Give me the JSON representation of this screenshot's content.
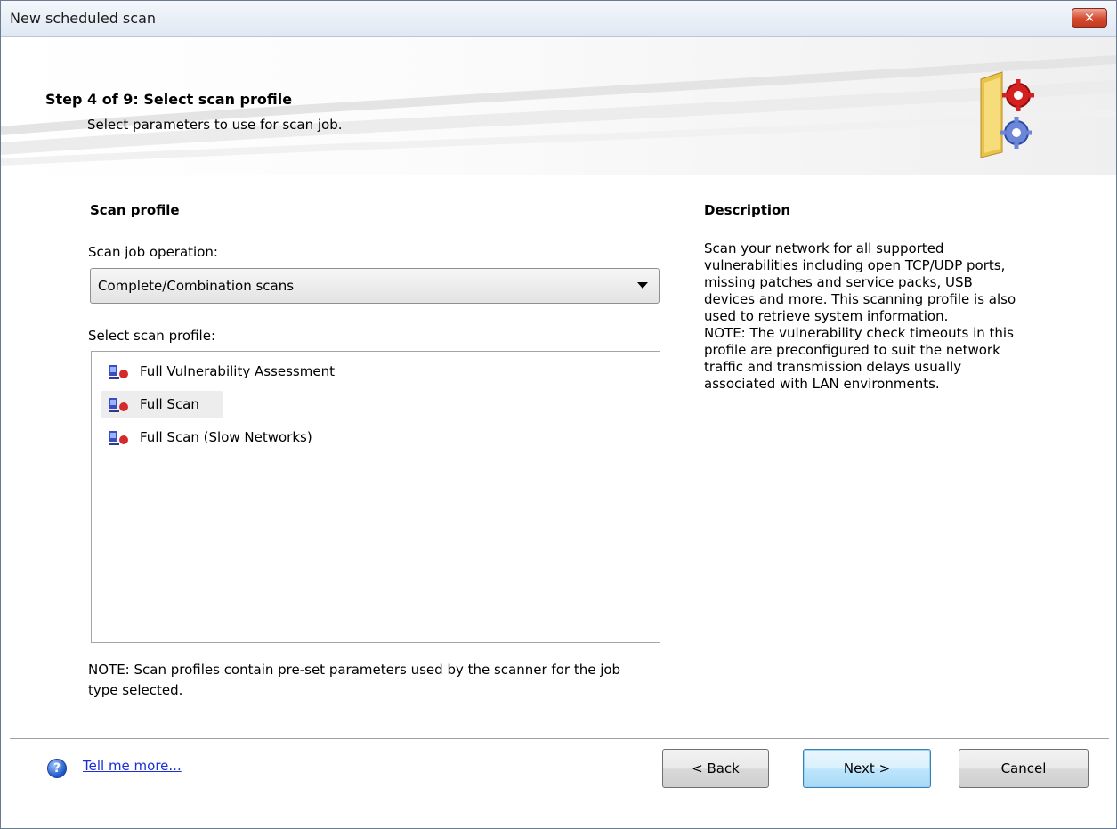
{
  "window": {
    "title": "New scheduled scan",
    "close_glyph": "✕"
  },
  "header": {
    "step_title": "Step 4 of 9: Select scan profile",
    "step_subtitle": "Select parameters to use for scan job.",
    "icon": "folder-gears-icon"
  },
  "scan_profile": {
    "section_title": "Scan profile",
    "operation_label": "Scan job operation:",
    "operation_value": "Complete/Combination scans",
    "profile_label": "Select scan profile:",
    "profiles": [
      {
        "label": "Full Vulnerability Assessment",
        "selected": false
      },
      {
        "label": "Full Scan",
        "selected": true
      },
      {
        "label": "Full Scan (Slow Networks)",
        "selected": false
      }
    ],
    "note": "NOTE: Scan profiles contain pre-set parameters used by the scanner for the job type selected."
  },
  "description": {
    "section_title": "Description",
    "lines": [
      "Scan your network for all supported",
      "vulnerabilities including open TCP/UDP ports,",
      "missing patches and service packs, USB",
      "devices and more. This scanning profile is also",
      "used to retrieve system information.",
      "NOTE: The vulnerability check timeouts in this",
      "profile are preconfigured to suit the network",
      "traffic and transmission delays usually",
      "associated with LAN environments."
    ]
  },
  "footer": {
    "help_icon": "help-icon",
    "help_glyph": "?",
    "help_link": "Tell me more...",
    "back_label": "< Back",
    "next_label": "Next >",
    "cancel_label": "Cancel"
  },
  "colors": {
    "link": "#1a2fd9",
    "close_button": "#d34b30",
    "default_button_border": "#3c7fb1"
  }
}
